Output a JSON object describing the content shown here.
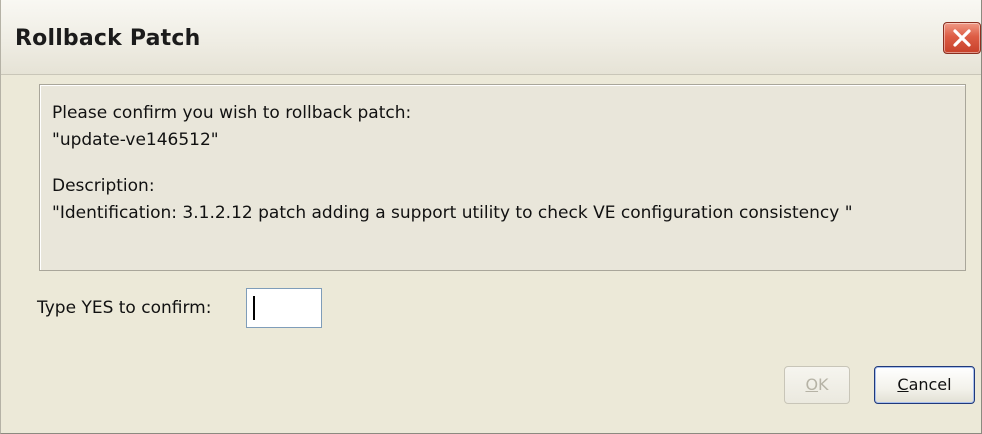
{
  "dialog": {
    "title": "Rollback Patch",
    "close_icon": "close-x-icon"
  },
  "info": {
    "line1": "Please confirm you wish to rollback patch:",
    "line2": "\"update-ve146512\"",
    "line3": "Description:",
    "line4": "\"Identification: 3.1.2.12 patch adding a support utility to check VE configuration consistency \""
  },
  "confirm": {
    "label": "Type YES to confirm:",
    "value": ""
  },
  "buttons": {
    "ok_mnemonic": "O",
    "ok_rest": "K",
    "ok_enabled": false,
    "cancel_mnemonic": "C",
    "cancel_rest": "ancel"
  },
  "colors": {
    "close_red": "#c7412a",
    "dialog_bg": "#ece9d8",
    "disabled_text": "#b6b3a6"
  }
}
